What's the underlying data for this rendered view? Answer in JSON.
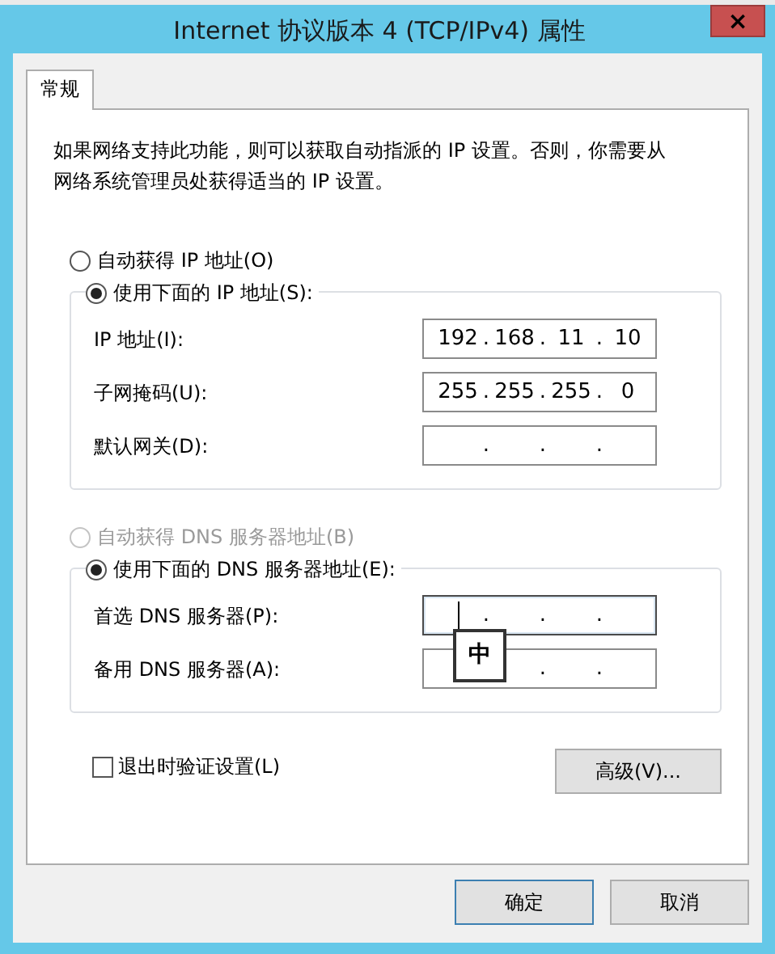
{
  "window": {
    "title": "Internet 协议版本 4 (TCP/IPv4) 属性",
    "close": "×"
  },
  "tabs": [
    {
      "label": "常规",
      "selected": true
    }
  ],
  "description": "如果网络支持此功能，则可以获取自动指派的 IP 设置。否则，你需要从网络系统管理员处获得适当的 IP 设置。",
  "ip_mode": [
    {
      "label": "自动获得 IP 地址(O)",
      "selected": false,
      "disabled": false
    },
    {
      "label": "使用下面的 IP 地址(S):",
      "selected": true,
      "disabled": false
    }
  ],
  "ip_fields": [
    {
      "label": "IP 地址(I):",
      "octets": [
        "192",
        "168",
        "11",
        "10"
      ],
      "dots": [
        ".",
        ".",
        "."
      ],
      "focused": false
    },
    {
      "label": "子网掩码(U):",
      "octets": [
        "255",
        "255",
        "255",
        "0"
      ],
      "dots": [
        ".",
        ".",
        "."
      ],
      "focused": false
    },
    {
      "label": "默认网关(D):",
      "dots": [
        ".",
        ".",
        "."
      ],
      "focused": false
    }
  ],
  "dns_mode": [
    {
      "label": "自动获得 DNS 服务器地址(B)",
      "selected": false,
      "disabled": true
    },
    {
      "label": "使用下面的 DNS 服务器地址(E):",
      "selected": true,
      "disabled": false
    }
  ],
  "dns_fields": [
    {
      "label": "首选 DNS 服务器(P):",
      "dots": [
        ".",
        ".",
        "."
      ],
      "focused": true
    },
    {
      "label": "备用 DNS 服务器(A):",
      "dots": [
        ".",
        "."
      ],
      "focused": false
    }
  ],
  "ime_indicator": "中",
  "validate_on_exit": {
    "label": "退出时验证设置(L)",
    "checked": false
  },
  "advanced_button": "高级(V)...",
  "buttons": [
    {
      "label": "确定",
      "default": true
    },
    {
      "label": "取消",
      "default": false
    }
  ]
}
